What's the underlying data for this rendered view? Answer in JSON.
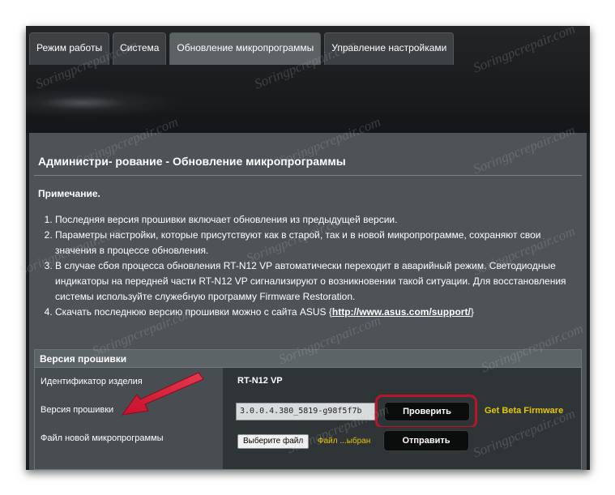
{
  "tabs": [
    {
      "label": "Режим работы"
    },
    {
      "label": "Система"
    },
    {
      "label": "Обновление микропрограммы"
    },
    {
      "label": "Управление настройками"
    }
  ],
  "active_tab": "Обновление микропрограммы",
  "page_title": "Администри- рование - Обновление микропрограммы",
  "note_heading": "Примечание.",
  "notes": [
    "Последняя версия прошивки включает обновления из предыдущей версии.",
    "Параметры настройки, которые присутствуют как в старой, так и в новой микропрограмме, сохраняют свои значения в процессе обновления.",
    "В случае сбоя процесса обновления RT-N12 VP автоматически переходит в аварийный режим. Светодиодные индикаторы на передней части RT-N12 VP сигнализируют о возникновении такой ситуации. Для восстановления системы используйте служебную программу Firmware Restoration.",
    "Скачать последнюю версию прошивки можно с сайта ASUS "
  ],
  "download_link": {
    "prefix": "{",
    "text": "http://www.asus.com/support/",
    "suffix": "}"
  },
  "firmware": {
    "section_title": "Версия прошивки",
    "product_id_label": "Идентификатор изделия",
    "product_id_value": "RT-N12 VP",
    "version_label": "Версия прошивки",
    "version_value": "3.0.0.4.380_5819-g98f5f7b",
    "check_button": "Проверить",
    "beta_link": "Get Beta Firmware",
    "new_file_label": "Файл новой микропрограммы",
    "choose_file_button": "Выберите файл",
    "file_status": "Файл ...ыбран",
    "upload_button": "Отправить"
  },
  "watermark": "Soringpcrepair.com",
  "colors": {
    "accent_highlight": "#b8152a",
    "link_yellow": "#e5c700",
    "panel": "#4d5356"
  }
}
